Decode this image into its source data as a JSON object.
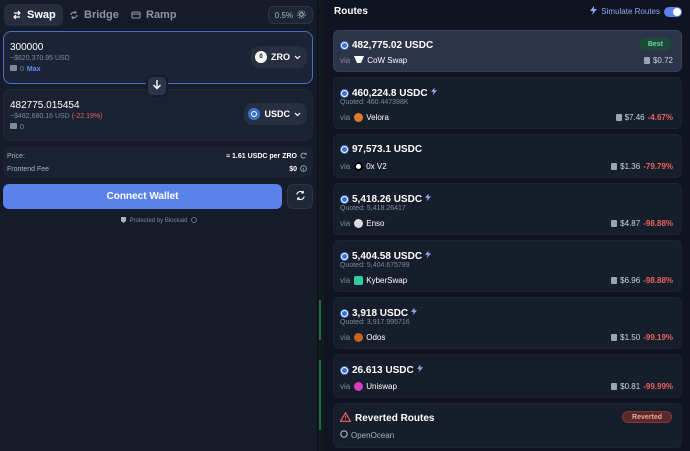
{
  "tabs": [
    {
      "label": "Swap",
      "icon": "swap-arrows-icon"
    },
    {
      "label": "Bridge",
      "icon": "bridge-icon"
    },
    {
      "label": "Ramp",
      "icon": "ramp-icon"
    }
  ],
  "slippage": "0.5%",
  "pay": {
    "amount": "300000",
    "usd": "~$620,370.95 USD",
    "balance": "0",
    "max_label": "Max",
    "token": "ZRO"
  },
  "receive": {
    "amount": "482775.015454",
    "usd": "~$482,680.16 USD",
    "impact": "(-22.19%)",
    "balance": "0",
    "token": "USDC"
  },
  "info": {
    "price_label": "Price:",
    "price_value": "≈ 1.61 USDC per ZRO",
    "fee_label": "Frontend Fee",
    "fee_value": "$0"
  },
  "connect_label": "Connect Wallet",
  "protected_label": "Protected by Blockaid",
  "routes_title": "Routes",
  "simulate_label": "Simulate Routes",
  "routes": [
    {
      "amount": "482,775.02 USDC",
      "quoted": "",
      "via": "via",
      "provider": "CoW Swap",
      "gas": "$0.72",
      "pct": "",
      "badge": "Best",
      "lightning": false,
      "provider_color": "#2b3448"
    },
    {
      "amount": "460,224.8 USDC",
      "quoted": "Quoted: 460.447398K",
      "via": "via",
      "provider": "Velora",
      "gas": "$7.46",
      "pct": "-4.67%",
      "badge": "",
      "lightning": true,
      "provider_color": "#e07a2b"
    },
    {
      "amount": "97,573.1 USDC",
      "quoted": "",
      "via": "via",
      "provider": "0x V2",
      "gas": "$1.36",
      "pct": "-79.79%",
      "badge": "",
      "lightning": false,
      "provider_color": "#444c5e"
    },
    {
      "amount": "5,418.26 USDC",
      "quoted": "Quoted: 5,418.26417",
      "via": "via",
      "provider": "Enso",
      "gas": "$4.87",
      "pct": "-98.88%",
      "badge": "",
      "lightning": true,
      "provider_color": "#d8dbe2"
    },
    {
      "amount": "5,404.58 USDC",
      "quoted": "Quoted: 5,404.675789",
      "via": "via",
      "provider": "KyberSwap",
      "gas": "$6.96",
      "pct": "-98.88%",
      "badge": "",
      "lightning": true,
      "provider_color": "#31cb9e"
    },
    {
      "amount": "3,918 USDC",
      "quoted": "Quoted: 3,917.995716",
      "via": "via",
      "provider": "Odos",
      "gas": "$1.50",
      "pct": "-99.19%",
      "badge": "",
      "lightning": true,
      "provider_color": "#c8641e"
    },
    {
      "amount": "26.613 USDC",
      "quoted": "",
      "via": "via",
      "provider": "Uniswap",
      "gas": "$0.81",
      "pct": "-99.99%",
      "badge": "",
      "lightning": true,
      "provider_color": "#d63dbd"
    }
  ],
  "reverted": {
    "title": "Reverted Routes",
    "badge": "Reverted",
    "provider": "OpenOcean"
  },
  "colors": {
    "accent": "#5b82ea",
    "negative": "#e8655f",
    "best_green": "#6fd3a0"
  }
}
